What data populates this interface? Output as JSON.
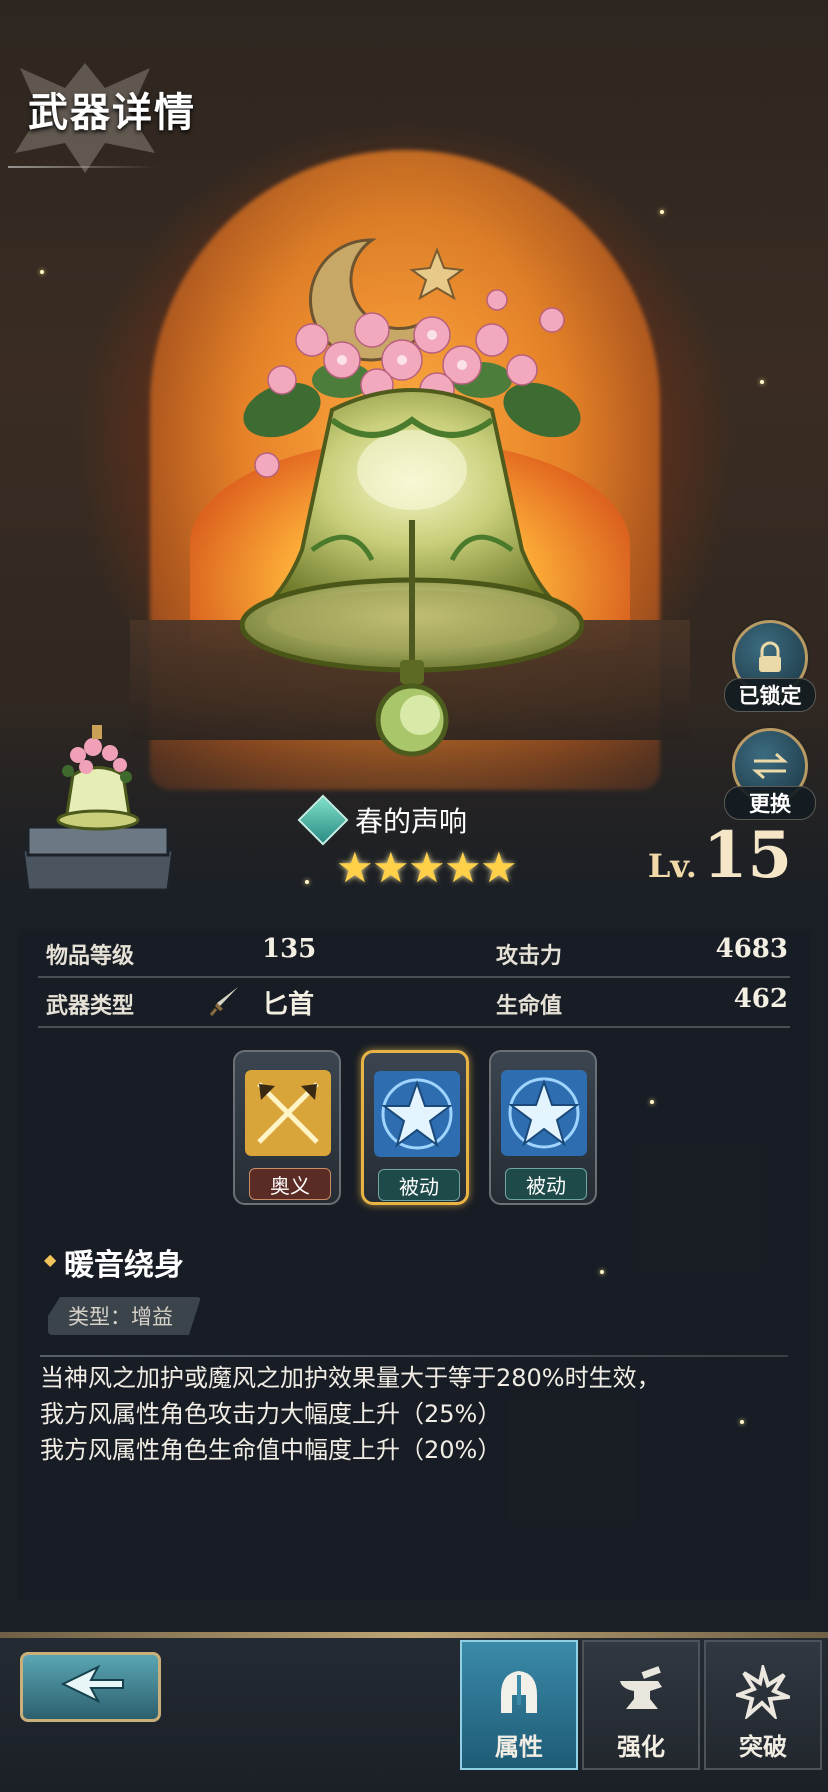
{
  "header": {
    "title": "武器详情"
  },
  "weapon": {
    "name": "春的声响",
    "rarity_stars": 5,
    "level_label": "Lv.",
    "level": "15",
    "element_icon": "wind-element-icon"
  },
  "side_buttons": {
    "lock": {
      "label": "已锁定",
      "icon": "lock-icon"
    },
    "swap": {
      "label": "更换",
      "icon": "swap-arrows-icon"
    }
  },
  "stats": {
    "item_level": {
      "label": "物品等级",
      "value": "135"
    },
    "attack": {
      "label": "攻击力",
      "value": "4683"
    },
    "weapon_type": {
      "label": "武器类型",
      "value": "匕首",
      "icon": "dagger-icon"
    },
    "hp": {
      "label": "生命值",
      "value": "462"
    }
  },
  "skills": [
    {
      "tag": "奥义",
      "icon": "crossed-swords-icon",
      "selected": false
    },
    {
      "tag": "被动",
      "icon": "star-icon",
      "selected": true
    },
    {
      "tag": "被动",
      "icon": "star-icon",
      "selected": false
    }
  ],
  "skill_detail": {
    "name": "暖音绕身",
    "type": "类型：增益",
    "description": [
      "当神风之加护或魔风之加护效果量大于等于280%时生效，",
      "我方风属性角色攻击力大幅度上升（25%）",
      "我方风属性角色生命值中幅度上升（20%）"
    ]
  },
  "bottom_nav": {
    "tabs": [
      {
        "label": "属性",
        "icon": "helmet-icon",
        "active": true
      },
      {
        "label": "强化",
        "icon": "anvil-icon",
        "active": false
      },
      {
        "label": "突破",
        "icon": "burst-icon",
        "active": false
      }
    ],
    "back_icon": "back-arrow-icon"
  },
  "colors": {
    "accent_gold": "#e8b446",
    "active_tab": "#3a8aa8",
    "star": "#ffd14a"
  }
}
